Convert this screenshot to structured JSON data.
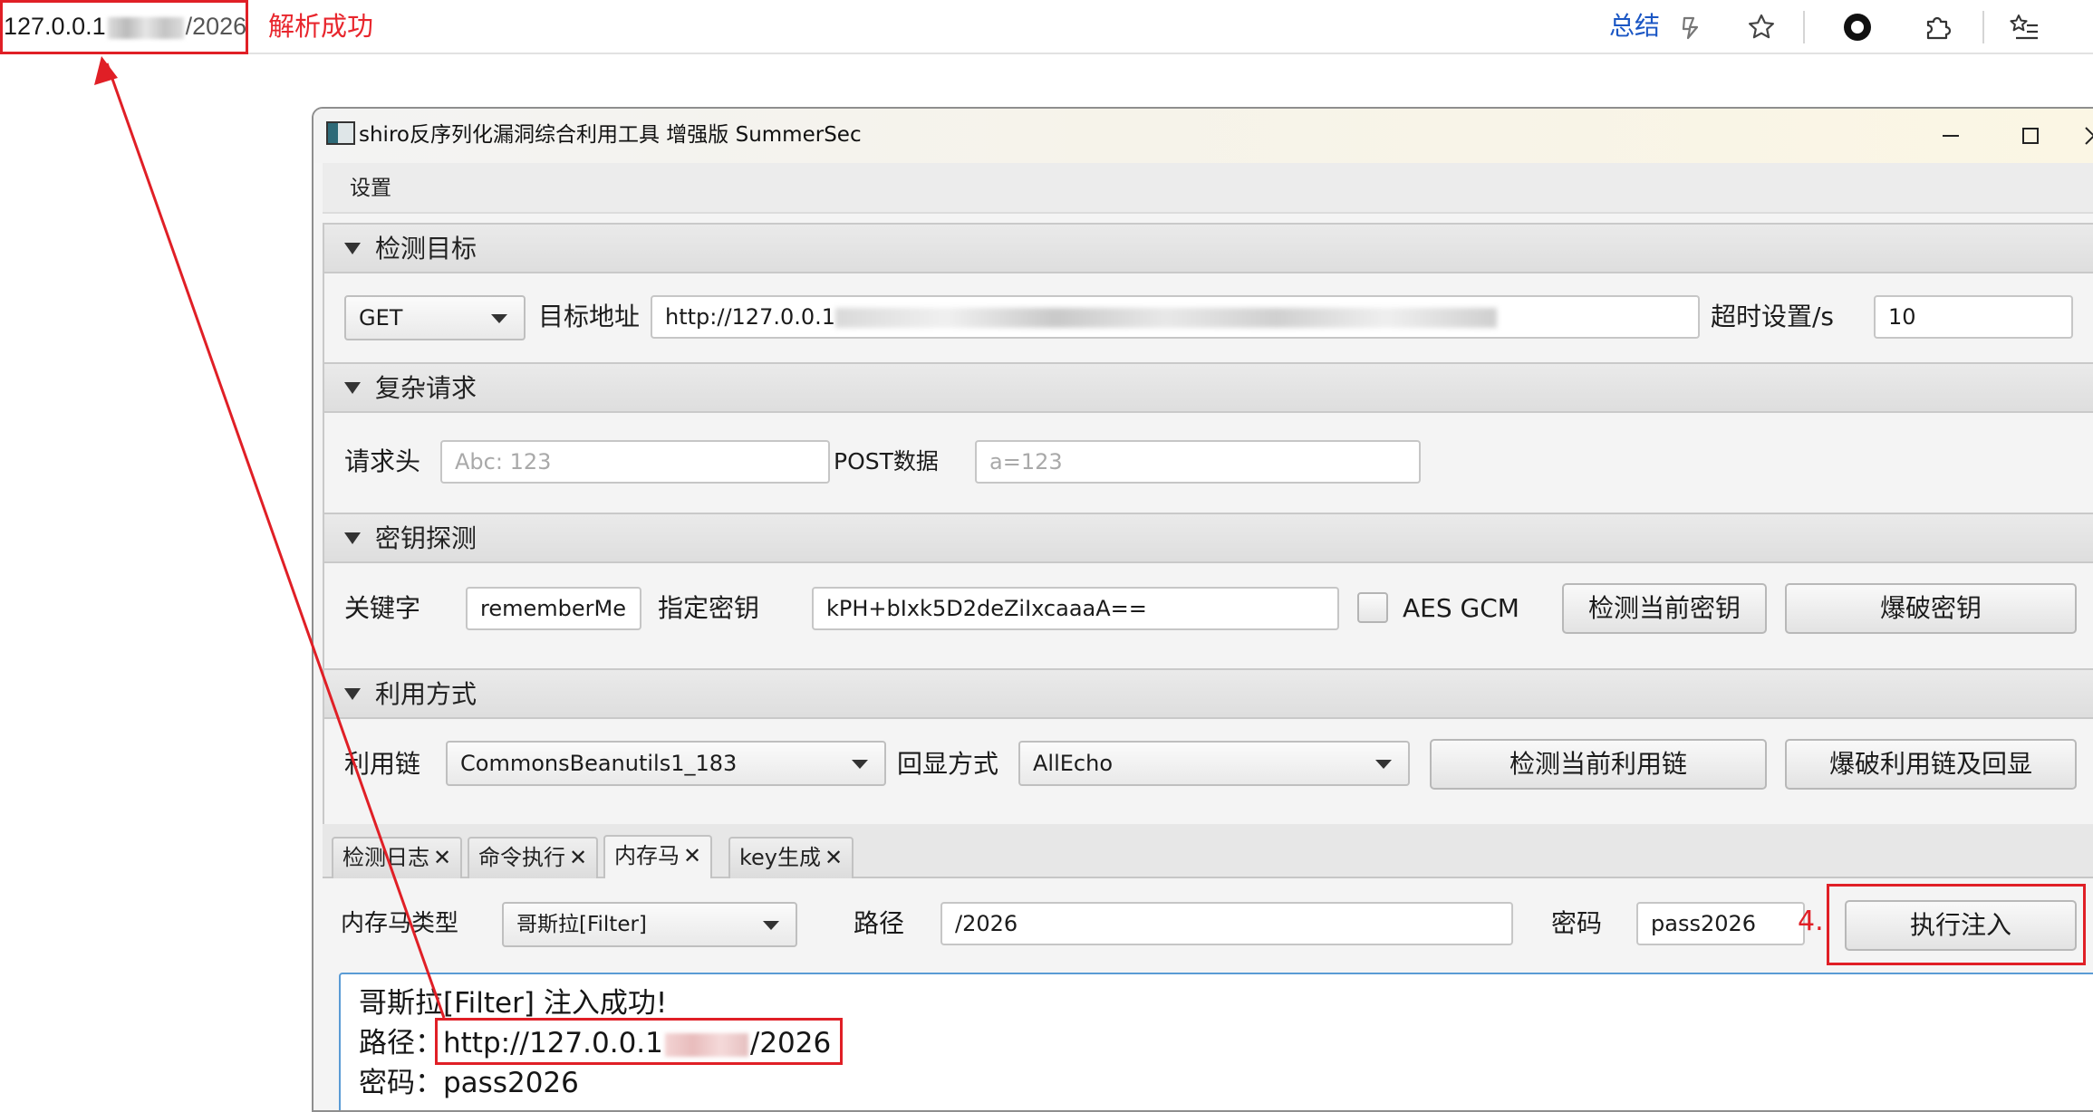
{
  "browser": {
    "address_prefix": "127.0.0.1",
    "address_suffix": "/2026",
    "parse_status": "解析成功",
    "summary_link": "总结",
    "icons": [
      "copilot-icon",
      "favorite-star-icon",
      "record-icon",
      "extensions-icon",
      "favorites-list-icon"
    ]
  },
  "app": {
    "title": "shiro反序列化漏洞综合利用工具 增强版 SummerSec",
    "menu": {
      "settings": "设置"
    },
    "sections": {
      "target": {
        "title": "检测目标",
        "method": "GET",
        "url_label": "目标地址",
        "url_value_prefix": "http://127.0.0.1",
        "timeout_label": "超时设置/s",
        "timeout_value": "10"
      },
      "complex": {
        "title": "复杂请求",
        "headers_label": "请求头",
        "headers_placeholder": "Abc: 123",
        "post_label": "POST数据",
        "post_placeholder": "a=123"
      },
      "key": {
        "title": "密钥探测",
        "keyword_label": "关键字",
        "keyword_value": "rememberMe",
        "key_label": "指定密钥",
        "key_value": "kPH+bIxk5D2deZiIxcaaaA==",
        "aes_gcm_label": "AES GCM",
        "aes_gcm_checked": false,
        "detect_key_button": "检测当前密钥",
        "brute_key_button": "爆破密钥"
      },
      "exploit": {
        "title": "利用方式",
        "chain_label": "利用链",
        "chain_value": "CommonsBeanutils1_183",
        "echo_label": "回显方式",
        "echo_value": "AllEcho",
        "detect_chain_button": "检测当前利用链",
        "brute_chain_button": "爆破利用链及回显"
      }
    },
    "tabs": [
      {
        "label": "检测日志",
        "active": false
      },
      {
        "label": "命令执行",
        "active": false
      },
      {
        "label": "内存马",
        "active": true
      },
      {
        "label": "key生成",
        "active": false
      }
    ],
    "memshell": {
      "type_label": "内存马类型",
      "type_value": "哥斯拉[Filter]",
      "path_label": "路径",
      "path_value": "/2026",
      "password_label": "密码",
      "password_value": "pass2026",
      "step_note": "4.",
      "inject_button": "执行注入"
    },
    "output": {
      "line1": "哥斯拉[Filter]  注入成功!",
      "line2_label": "路径：",
      "line2_prefix": "http://127.0.0.1",
      "line2_suffix": "/2026",
      "line3_label": "密码：",
      "line3_value": "pass2026"
    }
  },
  "colors": {
    "annotation_red": "#e01f26",
    "link_blue": "#1a56c4",
    "focus_blue": "#5a9bd5"
  }
}
